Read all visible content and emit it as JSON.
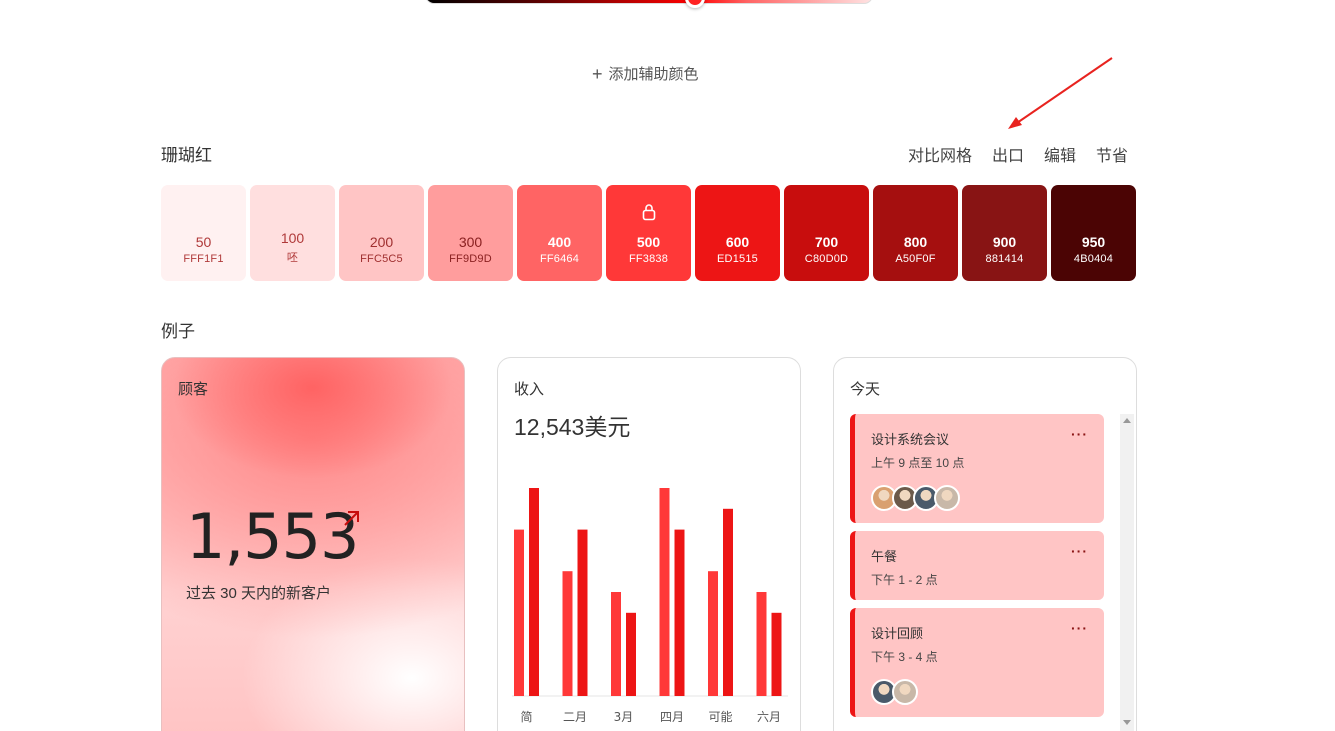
{
  "top": {
    "add_secondary_label": "添加辅助颜色"
  },
  "palette": {
    "name": "珊瑚红",
    "actions": {
      "contrast_grid": "对比网格",
      "export": "出口",
      "edit": "编辑",
      "save": "节省"
    },
    "swatches": [
      {
        "num": "50",
        "hex": "FFF1F1",
        "bg": "#fff1f1",
        "fg": "#b03a3a"
      },
      {
        "num": "100",
        "hex": "呸",
        "bg": "#ffdfdf",
        "fg": "#b03a3a"
      },
      {
        "num": "200",
        "hex": "FFC5C5",
        "bg": "#ffc5c5",
        "fg": "#a03030"
      },
      {
        "num": "300",
        "hex": "FF9D9D",
        "bg": "#ff9d9d",
        "fg": "#8a2020"
      },
      {
        "num": "400",
        "hex": "FF6464",
        "bg": "#ff6464",
        "fg": "#ffffff"
      },
      {
        "num": "500",
        "hex": "FF3838",
        "bg": "#ff3838",
        "fg": "#ffffff"
      },
      {
        "num": "600",
        "hex": "ED1515",
        "bg": "#ed1515",
        "fg": "#ffffff"
      },
      {
        "num": "700",
        "hex": "C80D0D",
        "bg": "#c80d0d",
        "fg": "#ffffff"
      },
      {
        "num": "800",
        "hex": "A50F0F",
        "bg": "#a50f0f",
        "fg": "#ffffff"
      },
      {
        "num": "900",
        "hex": "881414",
        "bg": "#881414",
        "fg": "#ffffff"
      },
      {
        "num": "950",
        "hex": "4B0404",
        "bg": "#4b0404",
        "fg": "#ffffff"
      }
    ],
    "locked_index": 5
  },
  "examples": {
    "title": "例子",
    "customers": {
      "title": "顾客",
      "value": "1,553",
      "subtitle": "过去 30 天内的新客户"
    },
    "revenue": {
      "title": "收入",
      "value": "12,543美元"
    },
    "today": {
      "title": "今天",
      "events": [
        {
          "title": "设计系统会议",
          "time": "上午 9 点至 10 点",
          "more": "···",
          "avatars": [
            "#d9a070",
            "#6b5a4a",
            "#4a5a6a",
            "#c8b8a8"
          ]
        },
        {
          "title": "午餐",
          "time": "下午 1 - 2 点",
          "more": "···",
          "avatars": []
        },
        {
          "title": "设计回顾",
          "time": "下午 3 - 4 点",
          "more": "···",
          "avatars": [
            "#4a5a6a",
            "#c8b8a8"
          ]
        }
      ]
    }
  },
  "chart_data": {
    "type": "bar",
    "categories": [
      "简",
      "二月",
      "3月",
      "四月",
      "可能",
      "六月"
    ],
    "series": [
      {
        "values": [
          80,
          60,
          50,
          100,
          60,
          50
        ],
        "color": "#ff3838"
      },
      {
        "values": [
          100,
          80,
          40,
          80,
          90,
          40
        ],
        "color": "#ed1515"
      }
    ],
    "ylim": [
      0,
      100
    ]
  }
}
